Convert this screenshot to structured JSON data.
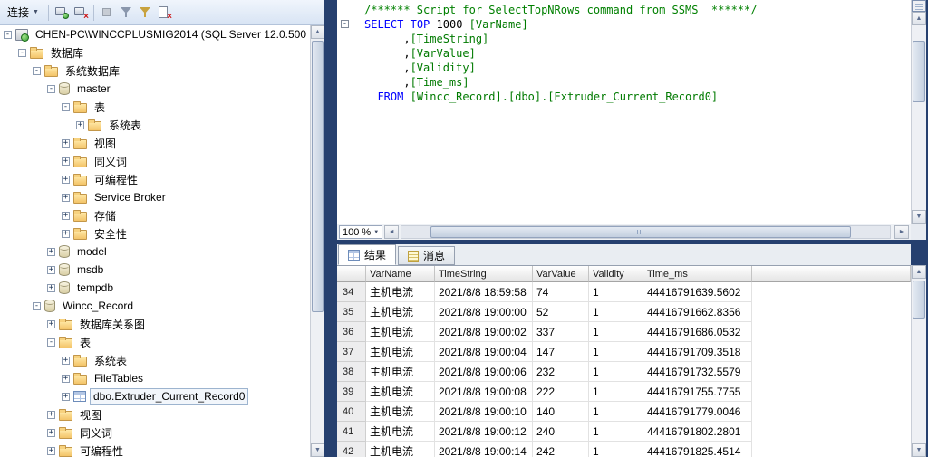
{
  "window": {
    "background": "#26406F"
  },
  "object_explorer": {
    "toolbar": {
      "connect_label": "连接",
      "icon_names": [
        "connect-server-icon",
        "disconnect-server-icon",
        "stop-icon",
        "filter-icon",
        "colored-filter-icon",
        "script-error-icon"
      ]
    },
    "tree": [
      {
        "label": "CHEN-PC\\WINCCPLUSMIG2014 (SQL Server 12.0.500",
        "level": 0,
        "expander": "minus",
        "icon": "server"
      },
      {
        "label": "数据库",
        "level": 1,
        "expander": "minus",
        "icon": "folder"
      },
      {
        "label": "系统数据库",
        "level": 2,
        "expander": "minus",
        "icon": "folder"
      },
      {
        "label": "master",
        "level": 3,
        "expander": "minus",
        "icon": "db"
      },
      {
        "label": "表",
        "level": 4,
        "expander": "minus",
        "icon": "folder"
      },
      {
        "label": "系统表",
        "level": 5,
        "expander": "plus",
        "icon": "folder"
      },
      {
        "label": "视图",
        "level": 4,
        "expander": "plus",
        "icon": "folder"
      },
      {
        "label": "同义词",
        "level": 4,
        "expander": "plus",
        "icon": "folder"
      },
      {
        "label": "可编程性",
        "level": 4,
        "expander": "plus",
        "icon": "folder"
      },
      {
        "label": "Service Broker",
        "level": 4,
        "expander": "plus",
        "icon": "folder"
      },
      {
        "label": "存储",
        "level": 4,
        "expander": "plus",
        "icon": "folder"
      },
      {
        "label": "安全性",
        "level": 4,
        "expander": "plus",
        "icon": "folder"
      },
      {
        "label": "model",
        "level": 3,
        "expander": "plus",
        "icon": "db"
      },
      {
        "label": "msdb",
        "level": 3,
        "expander": "plus",
        "icon": "db"
      },
      {
        "label": "tempdb",
        "level": 3,
        "expander": "plus",
        "icon": "db"
      },
      {
        "label": "Wincc_Record",
        "level": 2,
        "expander": "minus",
        "icon": "db"
      },
      {
        "label": "数据库关系图",
        "level": 3,
        "expander": "plus",
        "icon": "folder"
      },
      {
        "label": "表",
        "level": 3,
        "expander": "minus",
        "icon": "folder"
      },
      {
        "label": "系统表",
        "level": 4,
        "expander": "plus",
        "icon": "folder"
      },
      {
        "label": "FileTables",
        "level": 4,
        "expander": "plus",
        "icon": "folder"
      },
      {
        "label": "dbo.Extruder_Current_Record0",
        "level": 4,
        "expander": "plus",
        "icon": "table",
        "focused": true
      },
      {
        "label": "视图",
        "level": 3,
        "expander": "plus",
        "icon": "folder"
      },
      {
        "label": "同义词",
        "level": 3,
        "expander": "plus",
        "icon": "folder"
      },
      {
        "label": "可编程性",
        "level": 3,
        "expander": "plus",
        "icon": "folder"
      }
    ]
  },
  "editor": {
    "zoom_level": "100 %",
    "colors": {
      "keyword": "#0000ff",
      "comment": "#008000",
      "identifier": "#007a00"
    },
    "lines": [
      {
        "fold": "",
        "segments": [
          {
            "cls": "comment",
            "text": "/****** Script for SelectTopNRows command from SSMS  ******/"
          }
        ]
      },
      {
        "fold": "minus",
        "segments": [
          {
            "cls": "kw",
            "text": "SELECT"
          },
          {
            "cls": "plain",
            "text": " "
          },
          {
            "cls": "kw",
            "text": "TOP"
          },
          {
            "cls": "plain",
            "text": " "
          },
          {
            "cls": "num",
            "text": "1000"
          },
          {
            "cls": "plain",
            "text": " "
          },
          {
            "cls": "id",
            "text": "[VarName]"
          }
        ]
      },
      {
        "fold": "",
        "segments": [
          {
            "cls": "plain",
            "text": "      ,"
          },
          {
            "cls": "id",
            "text": "[TimeString]"
          }
        ]
      },
      {
        "fold": "",
        "segments": [
          {
            "cls": "plain",
            "text": "      ,"
          },
          {
            "cls": "id",
            "text": "[VarValue]"
          }
        ]
      },
      {
        "fold": "",
        "segments": [
          {
            "cls": "plain",
            "text": "      ,"
          },
          {
            "cls": "id",
            "text": "[Validity]"
          }
        ]
      },
      {
        "fold": "",
        "segments": [
          {
            "cls": "plain",
            "text": "      ,"
          },
          {
            "cls": "id",
            "text": "[Time_ms]"
          }
        ]
      },
      {
        "fold": "",
        "segments": [
          {
            "cls": "plain",
            "text": "  "
          },
          {
            "cls": "kw",
            "text": "FROM"
          },
          {
            "cls": "plain",
            "text": " "
          },
          {
            "cls": "id",
            "text": "[Wincc_Record].[dbo].[Extruder_Current_Record0]"
          }
        ]
      }
    ]
  },
  "results": {
    "tabs": [
      {
        "label": "结果"
      },
      {
        "label": "消息"
      }
    ],
    "grid": {
      "columns": [
        "VarName",
        "TimeString",
        "VarValue",
        "Validity",
        "Time_ms"
      ],
      "rows": [
        [
          "34",
          "主机电流",
          "2021/8/8 18:59:58",
          "74",
          "1",
          "44416791639.5602"
        ],
        [
          "35",
          "主机电流",
          "2021/8/8 19:00:00",
          "52",
          "1",
          "44416791662.8356"
        ],
        [
          "36",
          "主机电流",
          "2021/8/8 19:00:02",
          "337",
          "1",
          "44416791686.0532"
        ],
        [
          "37",
          "主机电流",
          "2021/8/8 19:00:04",
          "147",
          "1",
          "44416791709.3518"
        ],
        [
          "38",
          "主机电流",
          "2021/8/8 19:00:06",
          "232",
          "1",
          "44416791732.5579"
        ],
        [
          "39",
          "主机电流",
          "2021/8/8 19:00:08",
          "222",
          "1",
          "44416791755.7755"
        ],
        [
          "40",
          "主机电流",
          "2021/8/8 19:00:10",
          "140",
          "1",
          "44416791779.0046"
        ],
        [
          "41",
          "主机电流",
          "2021/8/8 19:00:12",
          "240",
          "1",
          "44416791802.2801"
        ],
        [
          "42",
          "主机电流",
          "2021/8/8 19:00:14",
          "242",
          "1",
          "44416791825.4514"
        ]
      ]
    }
  }
}
